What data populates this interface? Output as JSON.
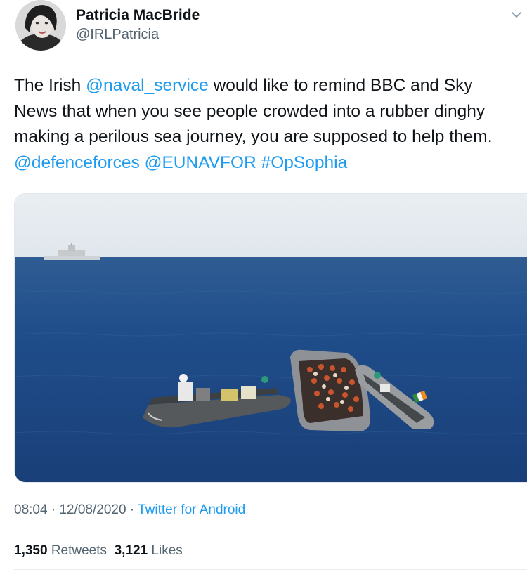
{
  "author": {
    "name": "Patricia MacBride",
    "handle": "@IRLPatricia"
  },
  "tweet": {
    "text_part1": "The Irish ",
    "mention_naval": "@naval_service",
    "text_part2": " would like to remind BBC and Sky News that when you see people crowded into a rubber dinghy making a perilous sea journey, you are supposed to help them. ",
    "mention_defence": "@defenceforces",
    "mention_eunavfor": "@EUNAVFOR",
    "hashtag": "#OpSophia"
  },
  "meta": {
    "time": "08:04",
    "date": "12/08/2020",
    "sep": " · ",
    "source": "Twitter for Android"
  },
  "stats": {
    "retweets_count": "1,350",
    "retweets_label": "Retweets",
    "likes_count": "3,121",
    "likes_label": "Likes"
  },
  "icons": {
    "more": "chevron-down-icon"
  }
}
